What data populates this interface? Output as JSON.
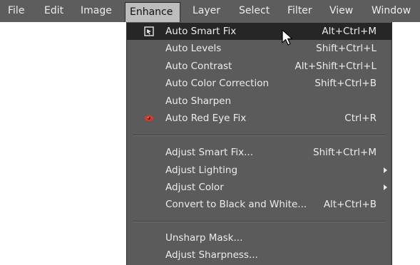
{
  "menubar": {
    "items": [
      {
        "label": "File"
      },
      {
        "label": "Edit"
      },
      {
        "label": "Image"
      },
      {
        "label": "Enhance"
      },
      {
        "label": "Layer"
      },
      {
        "label": "Select"
      },
      {
        "label": "Filter"
      },
      {
        "label": "View"
      },
      {
        "label": "Window"
      }
    ],
    "active": "Enhance"
  },
  "enhance_menu": {
    "groups": [
      [
        {
          "label": "Auto Smart Fix",
          "shortcut": "Alt+Ctrl+M",
          "icon": "auto-smart-fix-icon",
          "highlighted": true
        },
        {
          "label": "Auto Levels",
          "shortcut": "Shift+Ctrl+L"
        },
        {
          "label": "Auto Contrast",
          "shortcut": "Alt+Shift+Ctrl+L"
        },
        {
          "label": "Auto Color Correction",
          "shortcut": "Shift+Ctrl+B"
        },
        {
          "label": "Auto Sharpen",
          "shortcut": ""
        },
        {
          "label": "Auto Red Eye Fix",
          "shortcut": "Ctrl+R",
          "icon": "red-eye-icon"
        }
      ],
      [
        {
          "label": "Adjust Smart Fix...",
          "shortcut": "Shift+Ctrl+M"
        },
        {
          "label": "Adjust Lighting",
          "shortcut": "",
          "submenu": true
        },
        {
          "label": "Adjust Color",
          "shortcut": "",
          "submenu": true
        },
        {
          "label": "Convert to Black and White...",
          "shortcut": "Alt+Ctrl+B"
        }
      ],
      [
        {
          "label": "Unsharp Mask...",
          "shortcut": ""
        },
        {
          "label": "Adjust Sharpness...",
          "shortcut": ""
        }
      ]
    ]
  },
  "colors": {
    "menubar_bg": "#5d5d5d",
    "menu_bg": "#5b5b5b",
    "highlight_bg": "#262626",
    "text": "#ececec",
    "red_eye": "#d83a2c"
  }
}
